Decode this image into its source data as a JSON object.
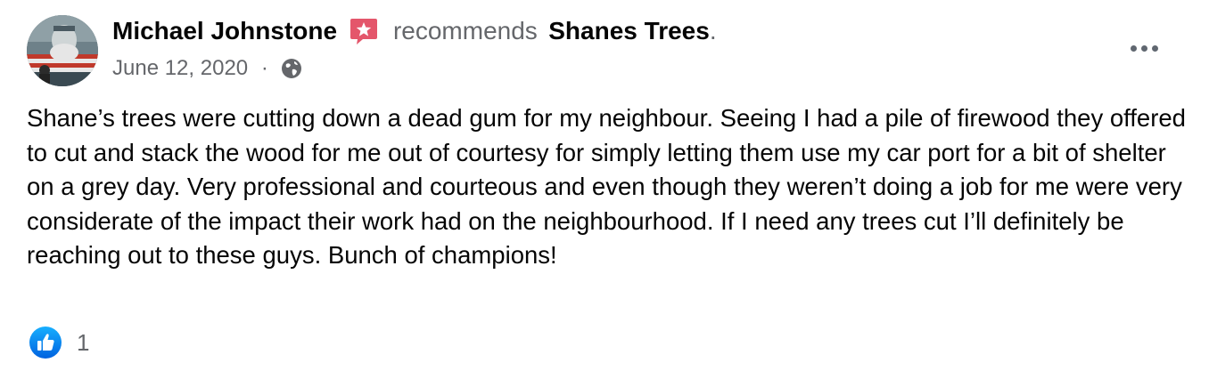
{
  "post": {
    "author": "Michael Johnstone",
    "action": "recommends",
    "page": "Shanes Trees",
    "period": ".",
    "date": "June 12, 2020",
    "separator": "·",
    "privacy_icon": "globe-icon",
    "recommend_icon": "recommendation-star-icon",
    "more_icon": "more-options-icon",
    "text": "Shane’s trees were cutting down a dead gum for my neighbour. Seeing I had a pile of firewood they offered to cut and stack the wood for me out of courtesy for simply letting them use my car port for a bit of shelter on a grey day. Very professional and courteous and even though they weren’t doing a job for me were very considerate of the impact their work had on the neighbourhood. If I need any trees cut I’ll definitely be reaching out to these guys. Bunch of champions!",
    "reactions": {
      "icon": "like-icon",
      "count": "1"
    }
  },
  "colors": {
    "text": "#050505",
    "secondary": "#65676b",
    "recommend_red": "#e4566b",
    "like_blue": "#1877f2"
  }
}
